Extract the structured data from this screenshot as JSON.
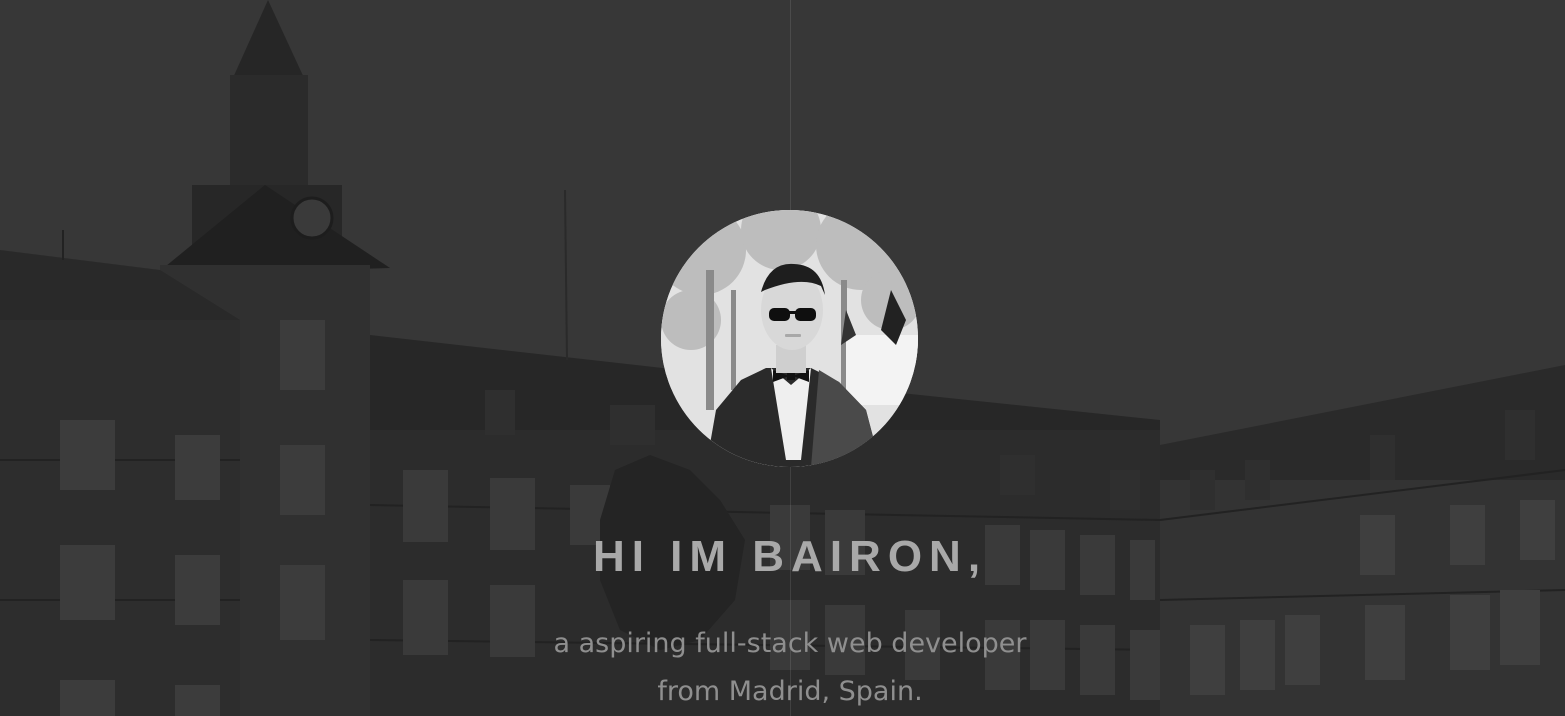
{
  "hero": {
    "headline": "HI IM BAIRON,",
    "tagline_line1": "a aspiring full-stack web developer",
    "tagline_line2": "from Madrid, Spain."
  },
  "colors": {
    "background": "#2e2e2e",
    "headline": "#a9a9a9",
    "tagline": "#8f8f8f"
  }
}
